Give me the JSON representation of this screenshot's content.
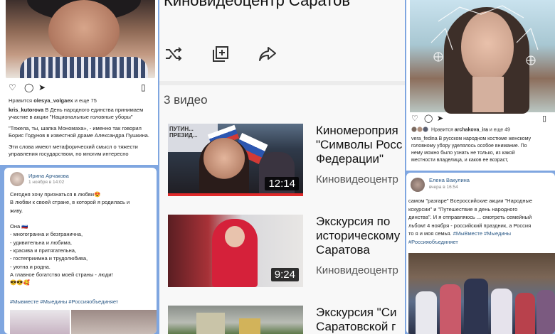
{
  "instagram_post_left": {
    "likes_prefix": "Нравится",
    "likes_user": "olesya_volgaex",
    "likes_suffix": "и еще 75",
    "author": "kris_kutorova",
    "caption_1": "В День народного единства принимаем участие в акции \"Национальные головные уборы\"",
    "caption_2": "\"Тяжела, ты, шапка Мономаха», - именно так говорил Борис Годунов в известной драме Александра Пушкина.",
    "caption_3": "Эти слова имеют метафорический смысл о тяжести управления государством, но многим интересно"
  },
  "vk_post_left": {
    "author": "Ирина Арчакова",
    "date": "1 ноября в 14:02",
    "lines": [
      "Сегодня хочу признаться в любви😍",
      "В любви к своей стране, в которой я родилась и",
      "живу.",
      "",
      "Она 🇷🇺",
      "- многогранна и безгранична,",
      "- удивительна и любима,",
      "- красива и притягательна,",
      "- гостеприимна и трудолюбива,",
      "- уютна и родна.",
      "А главное богатство моей страны - люди!",
      "😎😎🥰"
    ],
    "tags": "#Мывместе #Мыедины #Россияобъединяет"
  },
  "youtube": {
    "channel_title": "Киновидеоцентр Саратов",
    "video_count": "3 видео",
    "videos": [
      {
        "title_lines": [
          "Киномероприя",
          "\"Символы Росс",
          "Федерации\""
        ],
        "channel": "Киновидеоцентр",
        "duration": "12:14",
        "thumb_caption": "ПУТИН... ПРЕЗИД..."
      },
      {
        "title_lines": [
          "Экскурсия по",
          "историческому",
          "Саратова"
        ],
        "channel": "Киновидеоцентр",
        "duration": "9:24"
      },
      {
        "title_lines": [
          "Экскурсия \"Си",
          "Саратовской г"
        ],
        "channel": ""
      }
    ]
  },
  "instagram_post_right": {
    "likes_prefix": "Нравится",
    "likes_user": "archakova_ira",
    "likes_suffix": "и еще 49",
    "caption_lines": [
      "vera_fedina В русском народном костюме женскому",
      "головному убору уделялось особое внимание. По",
      "нему можно было узнать не только, из какой",
      "местности владелица, и каков ее возраст,"
    ]
  },
  "vk_post_right": {
    "author": "Елена Вакулина",
    "date": "вчера в 16:54",
    "lines": [
      "самом \"разгаре\" Всероссийские акции \"Народные",
      "кскурсии\" и \"Путешествие в день народного",
      "динства\". И я отправляюсь ... смотреть семейный",
      "льбом! 4 ноября - российский праздник, а Россия",
      "то я и моя семья."
    ],
    "tags_line_1": "#МыВместе #Мыедины",
    "tags_line_2": "#Россияобъединяет"
  }
}
